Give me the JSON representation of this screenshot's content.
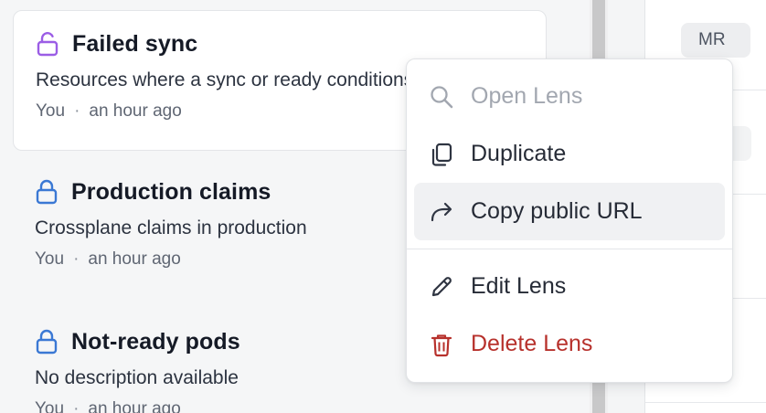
{
  "lenses": [
    {
      "title": "Failed sync",
      "description": "Resources where a sync or ready conditions are false",
      "author": "You",
      "time": "an hour ago",
      "lock": "unlocked-lock-icon",
      "lock_color": "#9b5de5"
    },
    {
      "title": "Production claims",
      "description": "Crossplane claims in production",
      "author": "You",
      "time": "an hour ago",
      "lock": "lock-icon",
      "lock_color": "#3a78d4"
    },
    {
      "title": "Not-ready pods",
      "description": "No description available",
      "author": "You",
      "time": "an hour ago",
      "lock": "lock-icon",
      "lock_color": "#3a78d4"
    }
  ],
  "meta_separator": "·",
  "right_panel": {
    "avatar_initials": "MR"
  },
  "menu": {
    "items": [
      {
        "label": "Open Lens",
        "icon": "search-icon",
        "state": "disabled"
      },
      {
        "label": "Duplicate",
        "icon": "duplicate-icon",
        "state": "normal"
      },
      {
        "label": "Copy public URL",
        "icon": "share-arrow-icon",
        "state": "hover"
      },
      {
        "label": "Edit Lens",
        "icon": "pencil-icon",
        "state": "normal"
      },
      {
        "label": "Delete Lens",
        "icon": "trash-icon",
        "state": "danger"
      }
    ]
  },
  "colors": {
    "accent_purple": "#9b5de5",
    "accent_blue": "#3a78d4",
    "danger": "#b7312c",
    "disabled": "#a2a7b0"
  }
}
